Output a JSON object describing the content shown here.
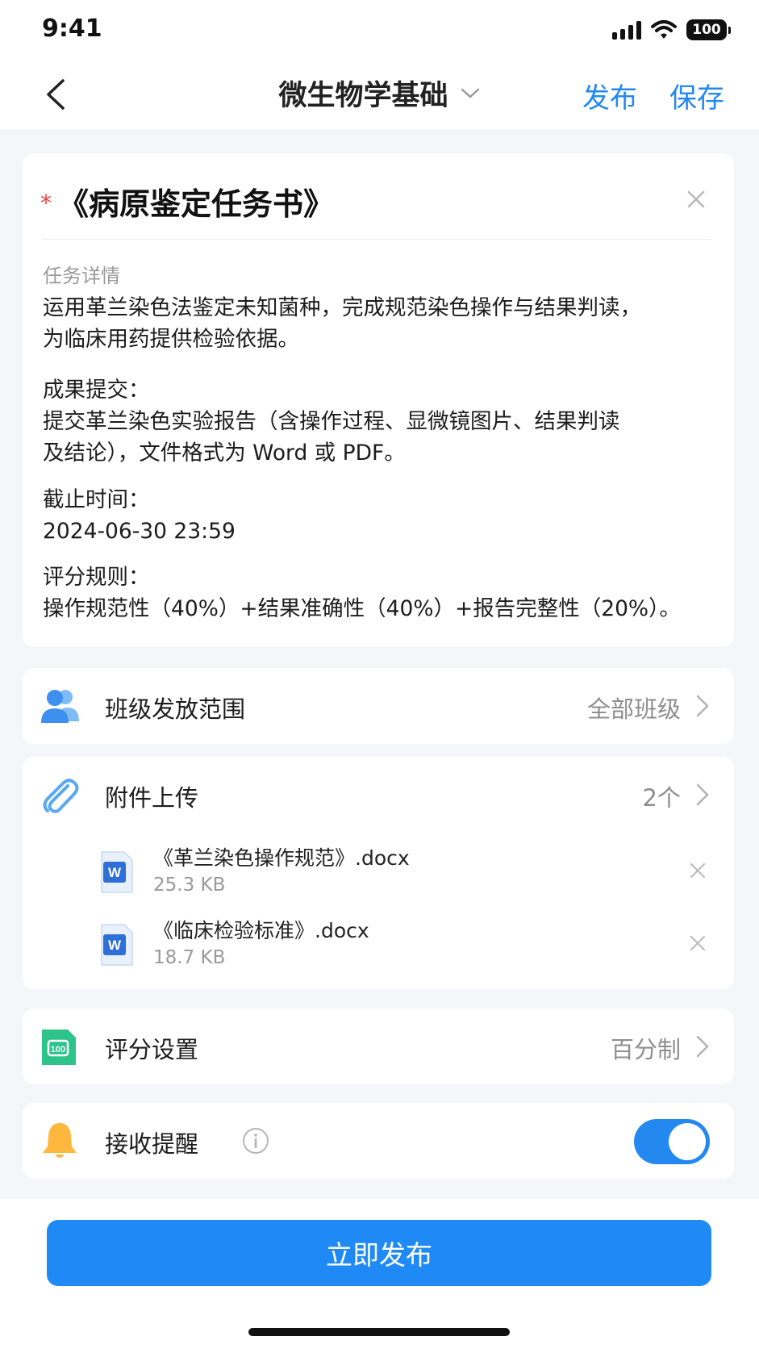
{
  "status_bar": {
    "time": "9:41",
    "battery": "100",
    "icons": [
      "signal-icon",
      "wifi-icon",
      "battery-icon"
    ]
  },
  "nav": {
    "title": "微生物学基础",
    "publish_label": "发布",
    "save_label": "保存",
    "accent_color": "#2389f0"
  },
  "task": {
    "title": "《病原鉴定任务书》",
    "detail_label": "任务详情",
    "description_lines": [
      "运用革兰染色法鉴定未知菌种，完成规范染色操作与结果判读，",
      "为临床用药提供检验依据。"
    ],
    "submission_label": "成果提交：",
    "submission_lines": [
      "提交革兰染色实验报告（含操作过程、显微镜图片、结果判读",
      "及结论），文件格式为 Word 或 PDF。"
    ],
    "deadline_label": "截止时间：",
    "deadline": "2024-06-30 23:59",
    "scoring_label": "评分规则：",
    "scoring_rule": "操作规范性（40%）+结果准确性（40%）+报告完整性（20%）。"
  },
  "class_scope": {
    "label": "班级发放范围",
    "value": "全部班级"
  },
  "attachments": {
    "label": "附件上传",
    "count": "2个",
    "files": [
      {
        "name": "《革兰染色操作规范》.docx",
        "size": "25.3 KB",
        "icon_text": "W"
      },
      {
        "name": "《临床检验标准》.docx",
        "size": "18.7 KB",
        "icon_text": "W"
      }
    ]
  },
  "score_settings": {
    "label": "评分设置",
    "value": "百分制"
  },
  "reminder": {
    "label": "接收提醒",
    "enabled": true
  },
  "footer": {
    "publish_now_label": "立即发布"
  }
}
